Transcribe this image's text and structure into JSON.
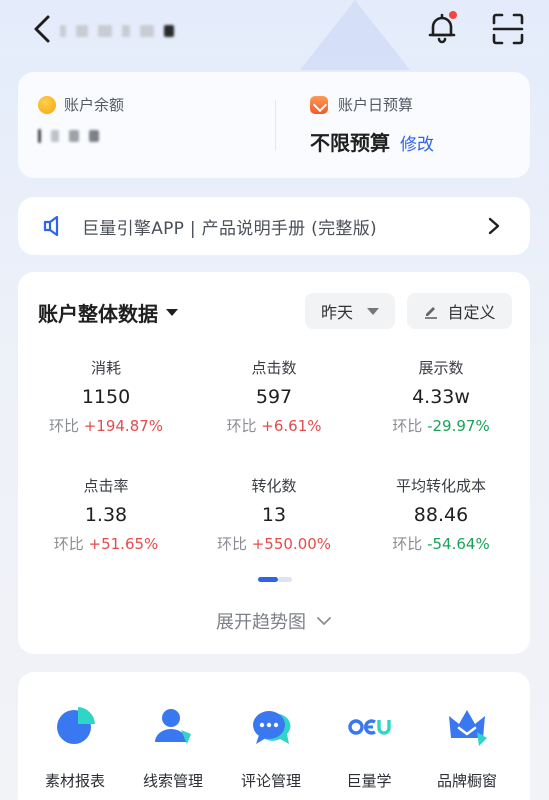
{
  "header": {
    "back_icon": "chevron-left-icon",
    "account_name_redacted": true,
    "bell_icon": "bell-icon",
    "notification_dot_color": "#f0483e",
    "scan_icon": "scan-icon"
  },
  "balance": {
    "label": "账户余额",
    "value_redacted": true,
    "icon": "coin-icon"
  },
  "daily_budget": {
    "label": "账户日预算",
    "value": "不限预算",
    "edit_label": "修改",
    "icon": "budget-icon"
  },
  "manual_banner": {
    "text": "巨量引擎APP | 产品说明手册 (完整版)",
    "icon": "speaker-icon"
  },
  "overview": {
    "title": "账户整体数据",
    "date_range": "昨天",
    "custom_label": "自定义",
    "change_prefix": "环比",
    "metrics": [
      {
        "label": "消耗",
        "value": "1150",
        "change": "+194.87%",
        "trend": "up"
      },
      {
        "label": "点击数",
        "value": "597",
        "change": "+6.61%",
        "trend": "up"
      },
      {
        "label": "展示数",
        "value": "4.33w",
        "change": "-29.97%",
        "trend": "down"
      },
      {
        "label": "点击率",
        "value": "1.38",
        "change": "+51.65%",
        "trend": "up"
      },
      {
        "label": "转化数",
        "value": "13",
        "change": "+550.00%",
        "trend": "up"
      },
      {
        "label": "平均转化成本",
        "value": "88.46",
        "change": "-54.64%",
        "trend": "down"
      }
    ],
    "pager": {
      "page": 1,
      "total": 2
    },
    "expand_label": "展开趋势图"
  },
  "tools": [
    {
      "label": "素材报表",
      "icon": "pie-chart-icon"
    },
    {
      "label": "线索管理",
      "icon": "user-lead-icon"
    },
    {
      "label": "评论管理",
      "icon": "chat-bubble-icon"
    },
    {
      "label": "巨量学",
      "icon": "oceanengine-learn-icon"
    },
    {
      "label": "品牌橱窗",
      "icon": "brand-showcase-icon"
    }
  ],
  "colors": {
    "accent": "#2f64e8",
    "increase": "#e54b4b",
    "decrease": "#1aa35a"
  }
}
